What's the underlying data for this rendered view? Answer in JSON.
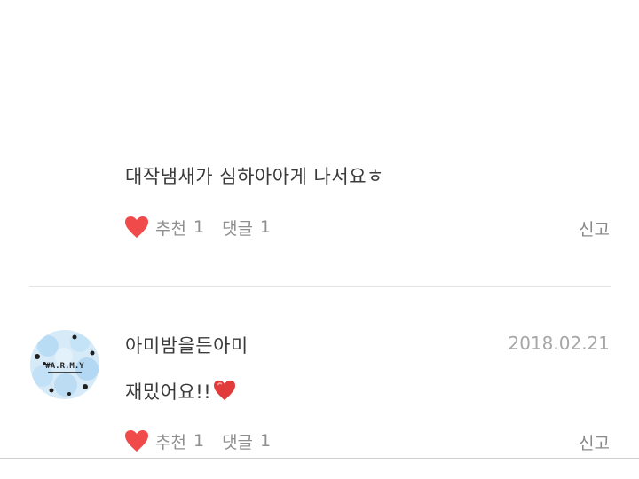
{
  "comments": [
    {
      "body": "대작냄새가 심하아아게 나서요ㅎ",
      "like_label": "추천",
      "like_count": "1",
      "reply_label": "댓글",
      "reply_count": "1",
      "report_label": "신고"
    },
    {
      "username": "아미밤을든아미",
      "date": "2018.02.21",
      "body": "재밌어요!!",
      "body_emoji": "red-heart-emoji",
      "avatar_text": "#A.R.M.Y",
      "like_label": "추천",
      "like_count": "1",
      "reply_label": "댓글",
      "reply_count": "1",
      "report_label": "신고"
    }
  ],
  "colors": {
    "heart": "#f04a4a",
    "text": "#3a3a3a",
    "muted": "#8f8f8f",
    "divider": "#e3e3e3"
  }
}
